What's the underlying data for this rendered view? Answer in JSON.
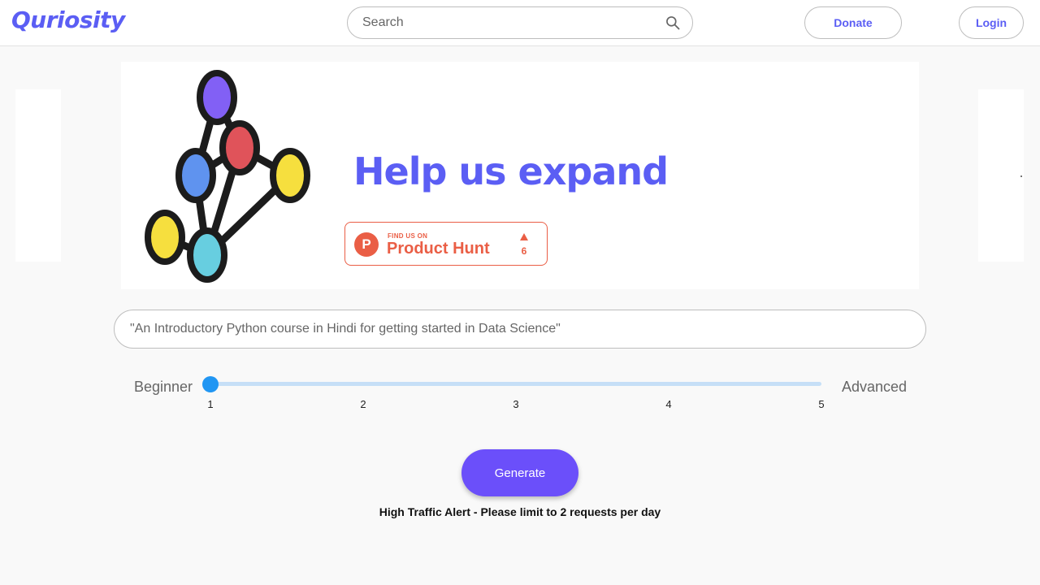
{
  "header": {
    "logo": "Quriosity",
    "search": {
      "placeholder": "Search",
      "value": ""
    },
    "donate_label": "Donate",
    "login_label": "Login"
  },
  "banner": {
    "title": "Help us expand",
    "product_hunt": {
      "find_us_on": "FIND US ON",
      "name": "Product Hunt",
      "logo_letter": "P",
      "upvotes": "6"
    }
  },
  "prompt": {
    "placeholder": "\"An Introductory Python course in Hindi for getting started in Data Science\"",
    "value": ""
  },
  "level": {
    "min_label": "Beginner",
    "max_label": "Advanced",
    "ticks": [
      "1",
      "2",
      "3",
      "4",
      "5"
    ],
    "min": 1,
    "max": 5,
    "value": 1
  },
  "generate_label": "Generate",
  "alert_text": "High Traffic Alert - Please limit to 2 requests per day",
  "colors": {
    "brand": "#5b5ef4",
    "button": "#6b4ffa",
    "slider": "#2196f3",
    "product_hunt": "#ea5e45",
    "graph_nodes": [
      "#8260f5",
      "#e0535a",
      "#5f93ef",
      "#f6df3e",
      "#f6df3e",
      "#67cee0"
    ]
  }
}
